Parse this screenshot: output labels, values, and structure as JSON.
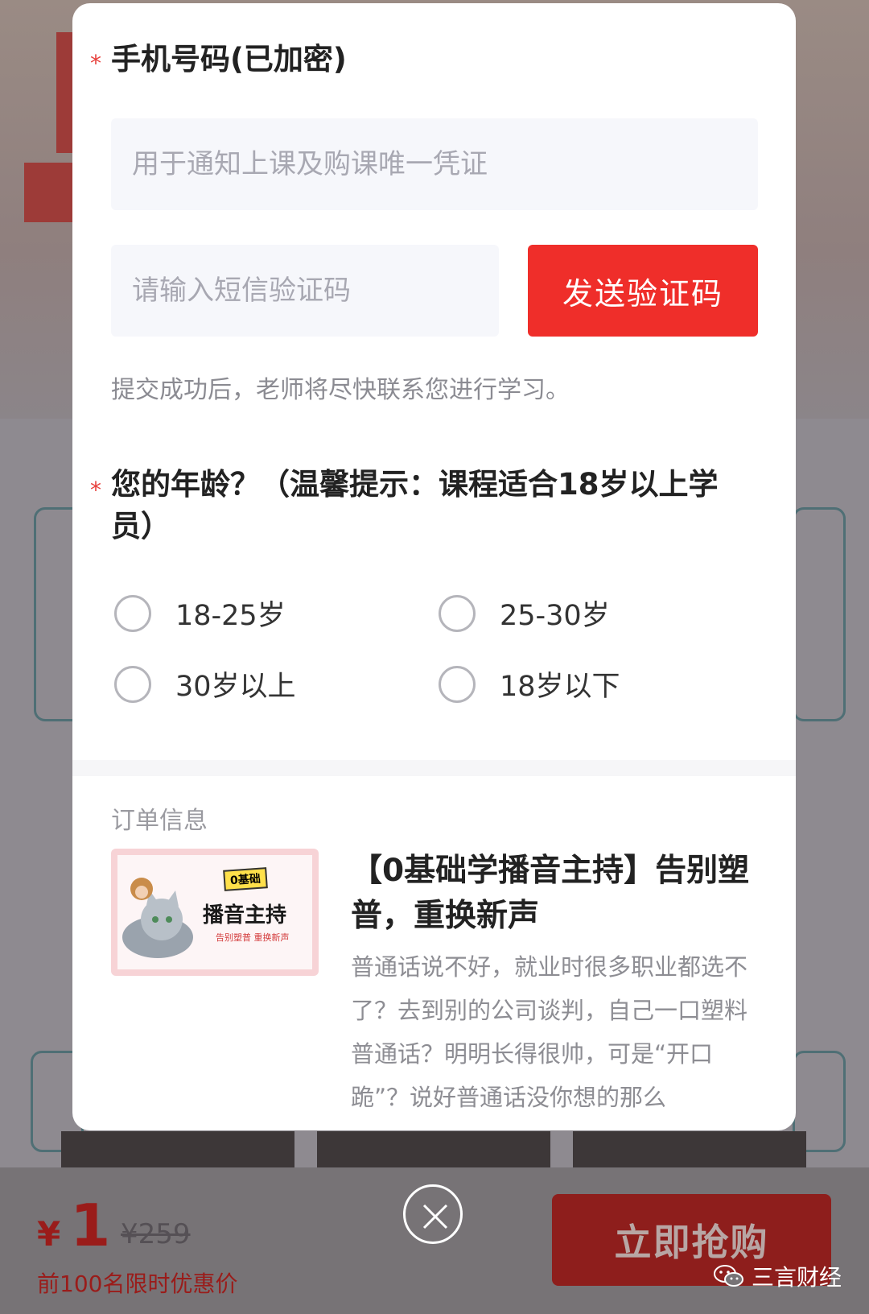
{
  "form": {
    "phone_label": "手机号码(已加密)",
    "phone_placeholder": "用于通知上课及购课唯一凭证",
    "sms_placeholder": "请输入短信验证码",
    "send_code_label": "发送验证码",
    "hint": "提交成功后，老师将尽快联系您进行学习。",
    "required_mark": "*",
    "age_question": "您的年龄？（温馨提示：课程适合18岁以上学员）",
    "age_options": [
      "18-25岁",
      "25-30岁",
      "30岁以上",
      "18岁以下"
    ]
  },
  "order": {
    "section_title": "订单信息",
    "course_title": "【0基础学播音主持】告别塑普，重换新声",
    "course_desc": "普通话说不好，就业时很多职业都选不了？去到别的公司谈判，自己一口塑料普通话？明明长得很帅，可是“开口跪”？说好普通话没你想的那么",
    "thumbnail": {
      "tag": "0基础",
      "title": "播音主持",
      "subtitle": "告别塑普 重换新声"
    }
  },
  "bottom_bar": {
    "currency": "¥",
    "price": "1",
    "original_price": "¥259",
    "promo": "前100名限时优惠价",
    "buy_label": "立即抢购"
  },
  "watermark": "三言财经",
  "colors": {
    "accent_red": "#ef2e2a",
    "required_star": "#e8413d",
    "overlay": "#8e8a90"
  },
  "icons": [
    "close-icon",
    "wechat-icon"
  ]
}
